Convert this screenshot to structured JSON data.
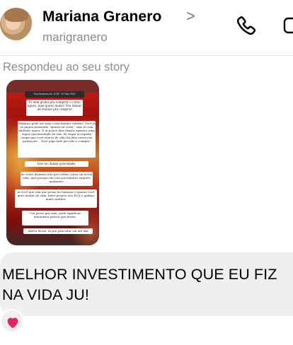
{
  "header": {
    "name": "Mariana Granero",
    "chevron": ">",
    "username": "marigranero",
    "icons": [
      "avatar",
      "phone-icon",
      "video-icon"
    ]
  },
  "thread": {
    "reply_label": "Respondeu ao seu story",
    "story": {
      "top_bar": "Rua Andrews em 11:59 · 07 Mar 2022",
      "cards": [
        "Tô sem grana pra comprar o curso agora, mas quero muito! Vou deixar de treinar pra comprar",
        "Dinheiro pode ser uma coisa muuito relativo. Você já se pegou pensando \"queria tal coisa\", mas tô sem dinheiro agora. E aí pouco dias depois aparece uma super oportunidade de sair, de viajar ou aquela roupa que você estava de olho há dias entrou na promoção... Você joga tudo pro alto e compra.",
        "Isso se chama prioridade.",
        "Às vezes dizemos não pra certas coisas na nossa vida, mas porque não são prioridades naquele momento.",
        "Aí você que tem que pesar na balança o quanto você quer mudar de vida, fazer projeto nos EUA e ganhar muito melhor.",
        "Um passo pra vida, pode significar muuuuitos passos pra frente.",
        "Alerta dessa, tá pra pancadar em até xxx"
      ]
    },
    "message": "MELHOR INVESTIMENTO QUE EU FIZ NA VIDA JU!",
    "reaction": "heart",
    "reaction_color": "#e0245e"
  }
}
